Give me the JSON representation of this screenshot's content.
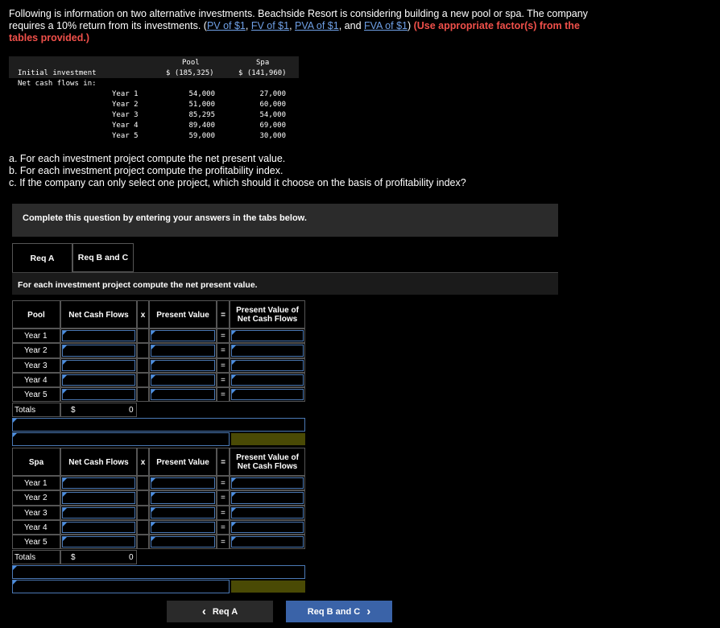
{
  "intro": {
    "text1": "Following is information on two alternative investments. Beachside Resort is considering building a new pool or spa. The company requires a 10% return from its investments. (",
    "link_pv": "PV of $1",
    "link_fv": "FV of $1",
    "link_pva": "PVA of $1",
    "and": ", and ",
    "link_fva": "FVA of $1",
    "close": ") ",
    "red": "(Use appropriate factor(s) from the tables provided.)"
  },
  "datatable": {
    "col_pool": "Pool",
    "col_spa": "Spa",
    "initial_label": "Initial investment",
    "initial_pool": "$ (185,325)",
    "initial_spa": "$ (141,960)",
    "netcash_label": "Net cash flows in:",
    "years": [
      "Year 1",
      "Year 2",
      "Year 3",
      "Year 4",
      "Year 5"
    ],
    "pool": [
      "54,000",
      "51,000",
      "85,295",
      "89,400",
      "59,000"
    ],
    "spa": [
      "27,000",
      "60,000",
      "54,000",
      "69,000",
      "30,000"
    ]
  },
  "questions": {
    "a": "a. For each investment project compute the net present value.",
    "b": "b. For each investment project compute the profitability index.",
    "c": "c. If the company can only select one project, which should it choose on the basis of profitability index?"
  },
  "complete_box": "Complete this question by entering your answers in the tabs below.",
  "tabs": {
    "req_a": "Req A",
    "req_bc": "Req B and C"
  },
  "instruction": "For each investment project compute the net present value.",
  "pool_table": {
    "title": "Pool",
    "h_ncf": "Net Cash Flows",
    "h_x": "x",
    "h_pv": "Present Value",
    "h_eq": "=",
    "h_pvncf": "Present Value of Net Cash Flows",
    "years": [
      "Year 1",
      "Year 2",
      "Year 3",
      "Year 4",
      "Year 5"
    ],
    "eq": "=",
    "totals": "Totals",
    "dollar": "$",
    "total_value": "0"
  },
  "spa_table": {
    "title": "Spa",
    "h_ncf": "Net Cash Flows",
    "h_x": "x",
    "h_pv": "Present Value",
    "h_eq": "=",
    "h_pvncf": "Present Value of Net Cash Flows",
    "years": [
      "Year 1",
      "Year 2",
      "Year 3",
      "Year 4",
      "Year 5"
    ],
    "eq": "=",
    "totals": "Totals",
    "dollar": "$",
    "total_value": "0"
  },
  "nav": {
    "prev": "Req A",
    "next": "Req B and C",
    "prev_icon": "‹",
    "next_icon": "›"
  },
  "colors": {
    "link": "#6fa0e6",
    "red": "#f0504a",
    "input_border": "#4b79b5",
    "nav_next": "#3a63a8",
    "highlight": "#4a4a05"
  }
}
